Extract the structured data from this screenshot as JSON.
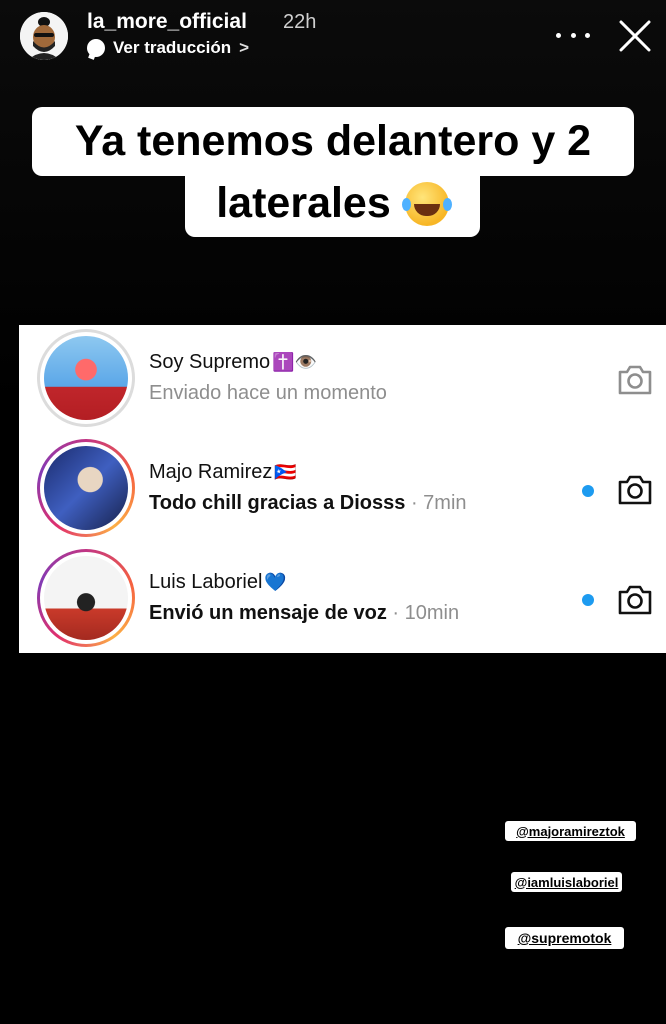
{
  "header": {
    "username": "la_more_official",
    "time": "22h",
    "translate_label": "Ver traducción",
    "translate_chevron": ">",
    "avatar_icon": "profile-avatar-icon",
    "more_icon": "more-dots-icon",
    "close_icon": "close-icon"
  },
  "caption": {
    "line1": "Ya tenemos delantero y 2",
    "line2": "laterales"
  },
  "messages": [
    {
      "name": "Soy Supremo",
      "name_emoji": "✝️👁️",
      "subtitle": "Enviado hace un momento",
      "ago": "",
      "unread": false
    },
    {
      "name": "Majo Ramirez",
      "name_emoji": "🇵🇷",
      "subtitle": "Todo chill gracias a Diosss",
      "ago": " · 7min",
      "unread": true
    },
    {
      "name": "Luis Laboriel",
      "name_emoji": "💙",
      "subtitle": "Envió un mensaje de voz",
      "ago": " · 10min",
      "unread": true
    }
  ],
  "mentions": [
    "@majoramireztok",
    "@iamluislaboriel",
    "@supremotok"
  ],
  "colors": {
    "unread_dot": "#1d9bf0",
    "muted_text": "#8e8e8e",
    "background": "#000000"
  }
}
